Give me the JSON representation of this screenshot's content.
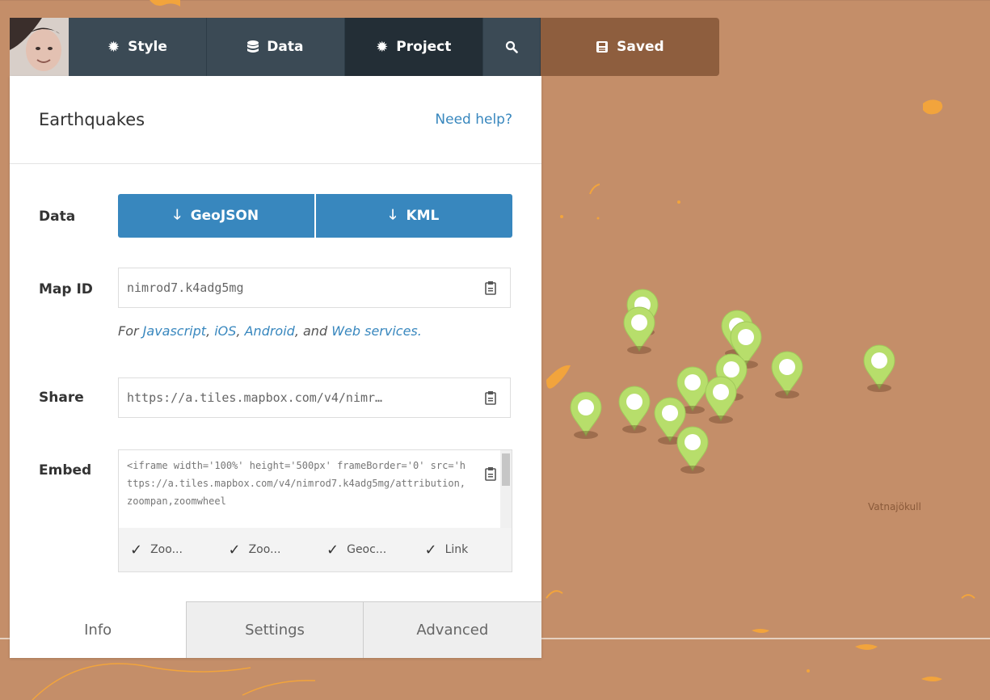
{
  "topbar": {
    "style_label": "Style",
    "data_label": "Data",
    "project_label": "Project",
    "saved_label": "Saved"
  },
  "panel": {
    "title": "Earthquakes",
    "help": "Need help?",
    "data_label": "Data",
    "geojson_label": "GeoJSON",
    "kml_label": "KML",
    "mapid_label": "Map ID",
    "mapid_value": "nimrod7.k4adg5mg",
    "hint_prefix": "For",
    "hint_javascript": "Javascript",
    "hint_ios": "iOS",
    "hint_android": "Android",
    "hint_and": "and",
    "hint_web": "Web services.",
    "share_label": "Share",
    "share_value": "https://a.tiles.mapbox.com/v4/nimr…",
    "embed_label": "Embed",
    "embed_code": "<iframe width='100%' height='500px' frameBorder='0' src='https://a.tiles.mapbox.com/v4/nimrod7.k4adg5mg/attribution,zoompan,zoomwheel",
    "options": [
      "Zoo...",
      "Zoo...",
      "Geoc...",
      "Link"
    ]
  },
  "tabs": [
    "Info",
    "Settings",
    "Advanced"
  ],
  "map": {
    "label": "Vatnajökull"
  },
  "colors": {
    "map_bg": "#c48e69",
    "accent": "#3887be",
    "topbar": "#3b4a55",
    "saved": "#8e5e3e",
    "pin": "#b7de6b"
  }
}
